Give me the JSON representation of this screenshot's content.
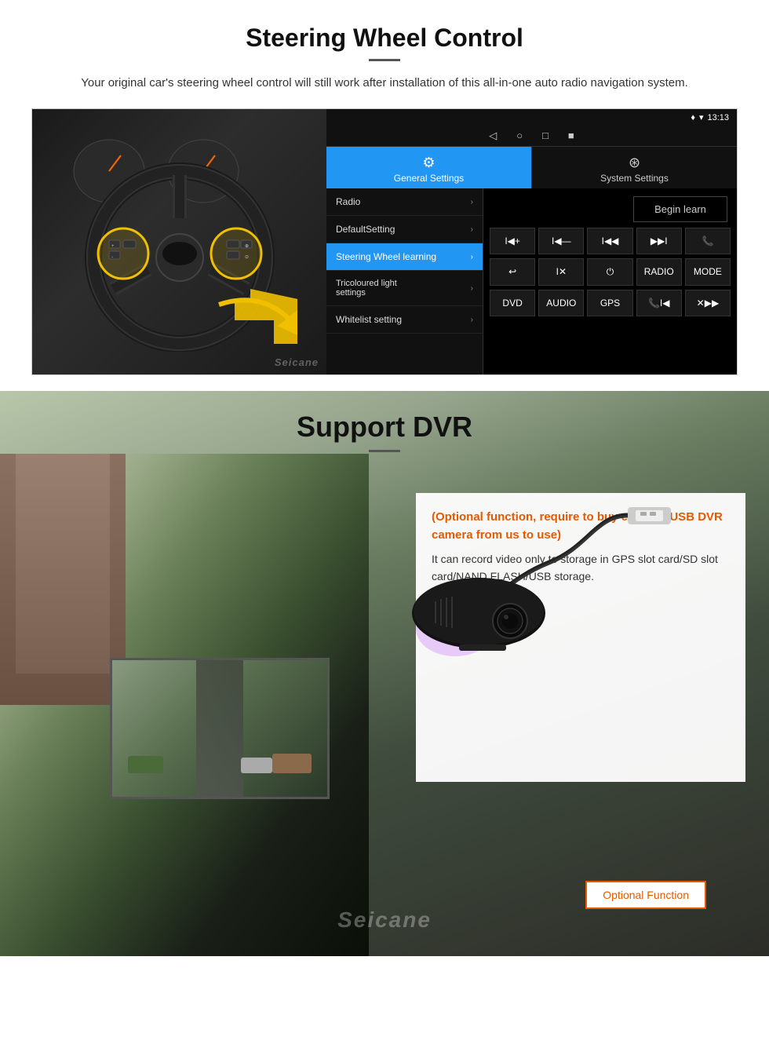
{
  "steering": {
    "title": "Steering Wheel Control",
    "description": "Your original car's steering wheel control will still work after installation of this all-in-one auto radio navigation system.",
    "status_bar": {
      "time": "13:13",
      "signal_icon": "▼",
      "wifi_icon": "▾"
    },
    "nav_icons": [
      "◁",
      "○",
      "□",
      "■"
    ],
    "tabs": {
      "general": {
        "icon": "⚙",
        "label": "General Settings"
      },
      "system": {
        "icon": "⊕",
        "label": "System Settings"
      }
    },
    "menu_items": [
      {
        "label": "Radio",
        "active": false
      },
      {
        "label": "DefaultSetting",
        "active": false
      },
      {
        "label": "Steering Wheel learning",
        "active": true
      },
      {
        "label": "Tricoloured light settings",
        "active": false
      },
      {
        "label": "Whitelist setting",
        "active": false
      }
    ],
    "begin_learn_label": "Begin learn",
    "control_buttons_row1": [
      "I◀+",
      "I◀—",
      "I◀◀",
      "▶▶I",
      "📞"
    ],
    "control_buttons_row2": [
      "↩",
      "I✕",
      "⏻",
      "RADIO",
      "MODE"
    ],
    "control_buttons_row3": [
      "DVD",
      "AUDIO",
      "GPS",
      "📞I◀",
      "✕▶▶"
    ]
  },
  "dvr": {
    "title": "Support DVR",
    "optional_text": "(Optional function, require to buy external USB DVR camera from us to use)",
    "description": "It can record video only to storage in GPS slot card/SD slot card/NAND FLASH/USB storage.",
    "optional_badge_label": "Optional Function"
  },
  "brand": {
    "watermark": "Seicane"
  }
}
